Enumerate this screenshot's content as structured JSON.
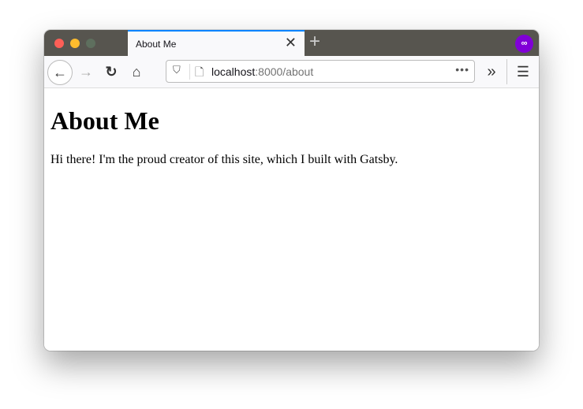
{
  "window": {
    "controls": [
      "close",
      "minimize",
      "zoom"
    ],
    "colors": {
      "close": "#fe5f57",
      "minimize": "#febc2e",
      "zoom": "#5e6f5e",
      "accent": "#0a84ff"
    }
  },
  "tab": {
    "title": "About Me",
    "close_icon": "close-icon"
  },
  "newtab": {
    "icon": "plus-icon"
  },
  "account": {
    "icon": "private-browsing-mask-icon",
    "color": "#8000d7"
  },
  "toolbar": {
    "back": "back-arrow-icon",
    "forward": "forward-arrow-icon",
    "reload": "reload-icon",
    "home": "home-icon"
  },
  "urlbar": {
    "host": "localhost",
    "rest": ":8000/about",
    "more": "•••"
  },
  "page": {
    "heading": "About Me",
    "paragraph": "Hi there! I'm the proud creator of this site, which I built with Gatsby."
  }
}
